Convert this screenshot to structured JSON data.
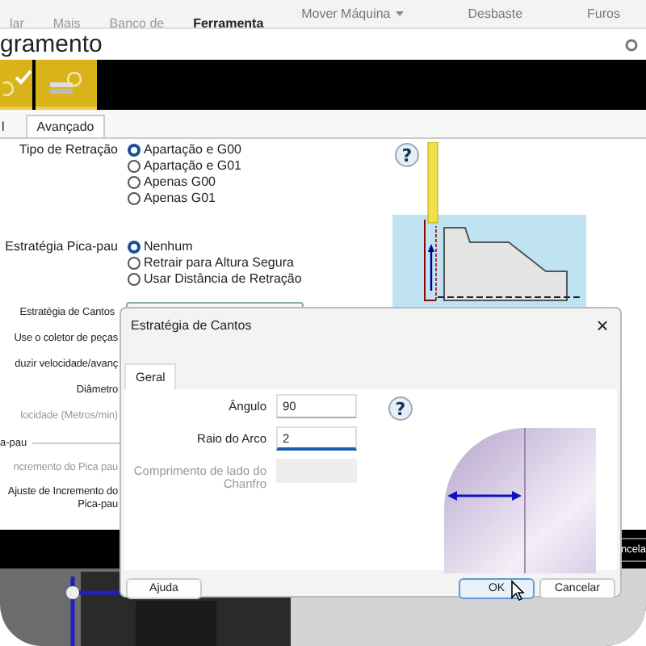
{
  "ribbon": {
    "large_buttons": [
      {
        "label": "lar",
        "selected": false
      },
      {
        "label": "Mais",
        "selected": false
      },
      {
        "label": "Banco de",
        "selected": false
      },
      {
        "label": "Ferramenta",
        "selected": true
      }
    ],
    "small_buttons": [
      {
        "label": "Mover Máquina",
        "dropdown": true
      },
      {
        "label": "Desbaste",
        "dropdown": false
      },
      {
        "label": "Furos",
        "dropdown": false
      }
    ]
  },
  "window": {
    "title": "gramento"
  },
  "toolbar": {
    "buttons": [
      {
        "kind": "confirm"
      },
      {
        "kind": "insert"
      }
    ]
  },
  "tabs": [
    {
      "label": "l",
      "selected": false
    },
    {
      "label": "Avançado",
      "selected": true
    }
  ],
  "form": {
    "groups": [
      {
        "label": "Tipo de Retração",
        "options": [
          {
            "label": "Apartação e G00",
            "selected": true
          },
          {
            "label": "Apartação e G01",
            "selected": false
          },
          {
            "label": "Apenas G00",
            "selected": false
          },
          {
            "label": "Apenas G01",
            "selected": false
          }
        ]
      },
      {
        "label": "Estratégia Pica-pau",
        "options": [
          {
            "label": "Nenhum",
            "selected": true
          },
          {
            "label": "Retrair para Altura Segura",
            "selected": false
          },
          {
            "label": "Usar Distância de Retração",
            "selected": false
          }
        ]
      }
    ],
    "rows": [
      {
        "label": "Estratégia de Cantos",
        "kind": "dropdown",
        "disabled": false
      },
      {
        "label": "Use o coletor de peças",
        "kind": "label",
        "disabled": false
      },
      {
        "label": "duzir velocidade/avanç",
        "kind": "label",
        "disabled": false
      },
      {
        "label": "Diâmetro",
        "kind": "label",
        "disabled": false
      },
      {
        "label": "locidade (Metros/min)",
        "kind": "label",
        "disabled": true
      },
      {
        "label": "a-pau",
        "kind": "group",
        "disabled": false
      },
      {
        "label": "ncremento do Pica pau",
        "kind": "label",
        "disabled": true
      },
      {
        "label": "Ajuste de Incremento do Pica-pau",
        "kind": "label",
        "disabled": false
      }
    ]
  },
  "help_icon": "?",
  "footer_bar": {
    "button": "ncela"
  },
  "dialog": {
    "title": "Estratégia de Cantos",
    "close": "×",
    "help_icon": "?",
    "tabs": [
      {
        "label": "Geral",
        "selected": true
      }
    ],
    "fields": [
      {
        "label": "Ângulo",
        "value": "90",
        "disabled": false,
        "focused": false
      },
      {
        "label": "Raio do Arco",
        "value": "2",
        "disabled": false,
        "focused": true
      },
      {
        "label": "Comprimento de lado do Chanfro",
        "disabled": true,
        "focused": false
      }
    ],
    "buttons": [
      {
        "label": "Ajuda",
        "default": false
      },
      {
        "label": "OK",
        "default": true
      },
      {
        "label": "Cancelar",
        "default": false
      }
    ]
  }
}
